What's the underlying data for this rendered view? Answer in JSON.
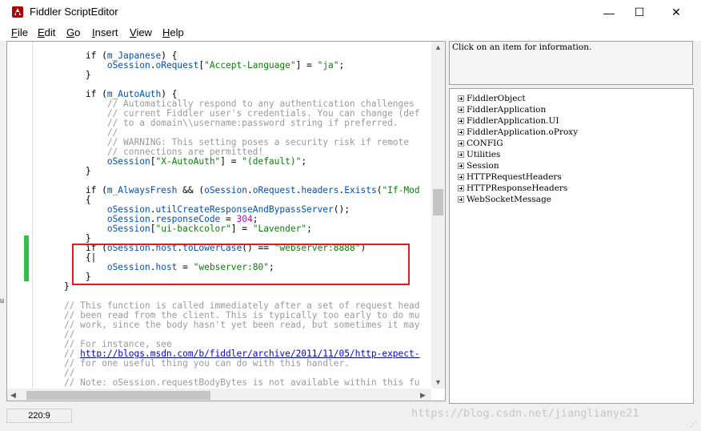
{
  "window": {
    "title": "Fiddler ScriptEditor",
    "minimize": "—",
    "maximize": "☐",
    "close": "✕"
  },
  "menu": [
    "File",
    "Edit",
    "Go",
    "Insert",
    "View",
    "Help"
  ],
  "menu_mnemonics": [
    "F",
    "E",
    "G",
    "I",
    "V",
    "H"
  ],
  "colors": {
    "keyword": "#000000",
    "member": "#0050b8",
    "string": "#0a7f0a",
    "comment": "#9a9a9a",
    "number": "#d000d0",
    "highlight_border": "#e8191b",
    "change_marker": "#2fbf4a"
  },
  "code_lines": [
    [
      [
        "kw",
        "        if ("
      ],
      [
        "fld",
        "m_Japanese"
      ],
      [
        "kw",
        ") {"
      ]
    ],
    [
      [
        "kw",
        "            "
      ],
      [
        "fld",
        "oSession"
      ],
      [
        "kw",
        "."
      ],
      [
        "fld",
        "oRequest"
      ],
      [
        "kw",
        "["
      ],
      [
        "str",
        "\"Accept-Language\""
      ],
      [
        "kw",
        "] = "
      ],
      [
        "str",
        "\"ja\""
      ],
      [
        "kw",
        ";"
      ]
    ],
    [
      [
        "kw",
        "        }"
      ]
    ],
    [
      [
        "kw",
        ""
      ]
    ],
    [
      [
        "kw",
        "        if ("
      ],
      [
        "fld",
        "m_AutoAuth"
      ],
      [
        "kw",
        ") {"
      ]
    ],
    [
      [
        "cm",
        "            // Automatically respond to any authentication challenges"
      ]
    ],
    [
      [
        "cm",
        "            // current Fiddler user's credentials. You can change (def"
      ]
    ],
    [
      [
        "cm",
        "            // to a domain\\\\username:password string if preferred."
      ]
    ],
    [
      [
        "cm",
        "            //"
      ]
    ],
    [
      [
        "cm",
        "            // WARNING: This setting poses a security risk if remote"
      ]
    ],
    [
      [
        "cm",
        "            // connections are permitted!"
      ]
    ],
    [
      [
        "kw",
        "            "
      ],
      [
        "fld",
        "oSession"
      ],
      [
        "kw",
        "["
      ],
      [
        "str",
        "\"X-AutoAuth\""
      ],
      [
        "kw",
        "] = "
      ],
      [
        "str",
        "\"(default)\""
      ],
      [
        "kw",
        ";"
      ]
    ],
    [
      [
        "kw",
        "        }"
      ]
    ],
    [
      [
        "kw",
        ""
      ]
    ],
    [
      [
        "kw",
        "        if ("
      ],
      [
        "fld",
        "m_AlwaysFresh"
      ],
      [
        "kw",
        " && ("
      ],
      [
        "fld",
        "oSession"
      ],
      [
        "kw",
        "."
      ],
      [
        "fld",
        "oRequest"
      ],
      [
        "kw",
        "."
      ],
      [
        "fld",
        "headers"
      ],
      [
        "kw",
        "."
      ],
      [
        "fld",
        "Exists"
      ],
      [
        "kw",
        "("
      ],
      [
        "str",
        "\"If-Mod"
      ]
    ],
    [
      [
        "kw",
        "        {"
      ]
    ],
    [
      [
        "kw",
        "            "
      ],
      [
        "fld",
        "oSession"
      ],
      [
        "kw",
        "."
      ],
      [
        "fld",
        "utilCreateResponseAndBypassServer"
      ],
      [
        "kw",
        "();"
      ]
    ],
    [
      [
        "kw",
        "            "
      ],
      [
        "fld",
        "oSession"
      ],
      [
        "kw",
        "."
      ],
      [
        "fld",
        "responseCode"
      ],
      [
        "kw",
        " = "
      ],
      [
        "num",
        "304"
      ],
      [
        "kw",
        ";"
      ]
    ],
    [
      [
        "kw",
        "            "
      ],
      [
        "fld",
        "oSession"
      ],
      [
        "kw",
        "["
      ],
      [
        "str",
        "\"ui-backcolor\""
      ],
      [
        "kw",
        "] = "
      ],
      [
        "str",
        "\"Lavender\""
      ],
      [
        "kw",
        ";"
      ]
    ],
    [
      [
        "kw",
        "        }"
      ]
    ],
    [
      [
        "kw",
        "        if ("
      ],
      [
        "fld",
        "oSession"
      ],
      [
        "kw",
        "."
      ],
      [
        "fld",
        "host"
      ],
      [
        "kw",
        "."
      ],
      [
        "fld",
        "toLowerCase"
      ],
      [
        "kw",
        "() == "
      ],
      [
        "str",
        "\"webserver:8888\""
      ],
      [
        "kw",
        ")"
      ]
    ],
    [
      [
        "kw",
        "        {|"
      ]
    ],
    [
      [
        "kw",
        "            "
      ],
      [
        "fld",
        "oSession"
      ],
      [
        "kw",
        "."
      ],
      [
        "fld",
        "host"
      ],
      [
        "kw",
        " = "
      ],
      [
        "str",
        "\"webserver:80\""
      ],
      [
        "kw",
        ";"
      ]
    ],
    [
      [
        "kw",
        "        }"
      ]
    ],
    [
      [
        "kw",
        "    }"
      ]
    ],
    [
      [
        "kw",
        ""
      ]
    ],
    [
      [
        "cm",
        "    // This function is called immediately after a set of request head"
      ]
    ],
    [
      [
        "cm",
        "    // been read from the client. This is typically too early to do mu"
      ]
    ],
    [
      [
        "cm",
        "    // work, since the body hasn't yet been read, but sometimes it may"
      ]
    ],
    [
      [
        "cm",
        "    //"
      ]
    ],
    [
      [
        "cm",
        "    // For instance, see"
      ]
    ],
    [
      [
        "cm",
        "    // "
      ],
      [
        "url",
        "http://blogs.msdn.com/b/fiddler/archive/2011/11/05/http-expect-"
      ]
    ],
    [
      [
        "cm",
        "    // for one useful thing you can do with this handler."
      ]
    ],
    [
      [
        "cm",
        "    //"
      ]
    ],
    [
      [
        "cm",
        "    // Note: oSession.requestBodyBytes is not available within this fu"
      ]
    ]
  ],
  "info_panel": {
    "text": "Click on an item for information."
  },
  "tree": [
    "FiddlerObject",
    "FiddlerApplication",
    "FiddlerApplication.UI",
    "FiddlerApplication.oProxy",
    "CONFIG",
    "Utilities",
    "Session",
    "HTTPRequestHeaders",
    "HTTPResponseHeaders",
    "WebSocketMessage"
  ],
  "status": {
    "position": "220:9"
  },
  "watermark": "https://blog.csdn.net/jianglianye21"
}
